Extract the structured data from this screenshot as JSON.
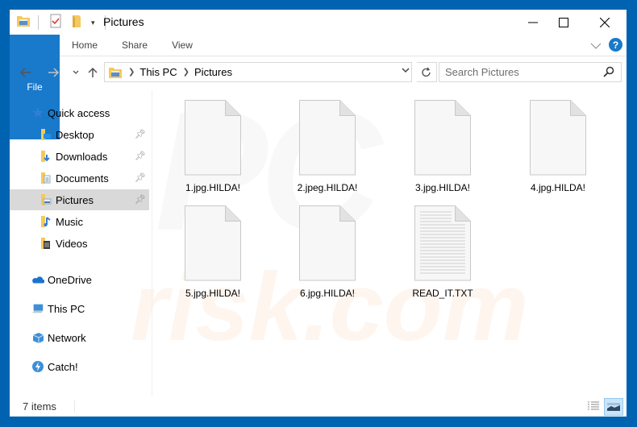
{
  "window": {
    "title": "Pictures",
    "controls": {
      "minimize": "minimize",
      "maximize": "maximize",
      "close": "close"
    }
  },
  "quick_access_toolbar": {
    "icons": [
      "folder-icon",
      "properties-icon",
      "new-folder-icon",
      "customize-dropdown-icon"
    ]
  },
  "ribbon": {
    "tabs": [
      {
        "label": "File",
        "active": true
      },
      {
        "label": "Home"
      },
      {
        "label": "Share"
      },
      {
        "label": "View"
      }
    ],
    "help": "?"
  },
  "navigation": {
    "back": "←",
    "forward": "→",
    "recent": "⌄",
    "up": "↑",
    "breadcrumb": [
      "This PC",
      "Pictures"
    ],
    "search_placeholder": "Search Pictures"
  },
  "sidebar": {
    "items": [
      {
        "label": "Quick access",
        "icon": "star-icon",
        "indent": 0
      },
      {
        "label": "Desktop",
        "icon": "desktop-folder-icon",
        "indent": 1,
        "pinned": true
      },
      {
        "label": "Downloads",
        "icon": "downloads-folder-icon",
        "indent": 1,
        "pinned": true
      },
      {
        "label": "Documents",
        "icon": "documents-folder-icon",
        "indent": 1,
        "pinned": true
      },
      {
        "label": "Pictures",
        "icon": "pictures-folder-icon",
        "indent": 1,
        "pinned": true,
        "selected": true
      },
      {
        "label": "Music",
        "icon": "music-folder-icon",
        "indent": 1
      },
      {
        "label": "Videos",
        "icon": "videos-folder-icon",
        "indent": 1
      },
      {
        "label": "OneDrive",
        "icon": "onedrive-icon",
        "indent": 0
      },
      {
        "label": "This PC",
        "icon": "this-pc-icon",
        "indent": 0
      },
      {
        "label": "Network",
        "icon": "network-icon",
        "indent": 0
      },
      {
        "label": "Catch!",
        "icon": "catch-icon",
        "indent": 0
      }
    ]
  },
  "files": [
    {
      "name": "1.jpg.HILDA!",
      "type": "blank"
    },
    {
      "name": "2.jpeg.HILDA!",
      "type": "blank"
    },
    {
      "name": "3.jpg.HILDA!",
      "type": "blank"
    },
    {
      "name": "4.jpg.HILDA!",
      "type": "blank"
    },
    {
      "name": "5.jpg.HILDA!",
      "type": "blank"
    },
    {
      "name": "6.jpg.HILDA!",
      "type": "blank"
    },
    {
      "name": "READ_IT.TXT",
      "type": "text"
    }
  ],
  "status": {
    "item_count": "7 items"
  },
  "watermark": {
    "line1": "PC",
    "line2": "risk.com"
  },
  "colors": {
    "frame": "#0063b1",
    "file_tab": "#1979ca",
    "selected_item": "#d9d9d9",
    "help": "#1979ca",
    "watermark": "#f26d21"
  }
}
